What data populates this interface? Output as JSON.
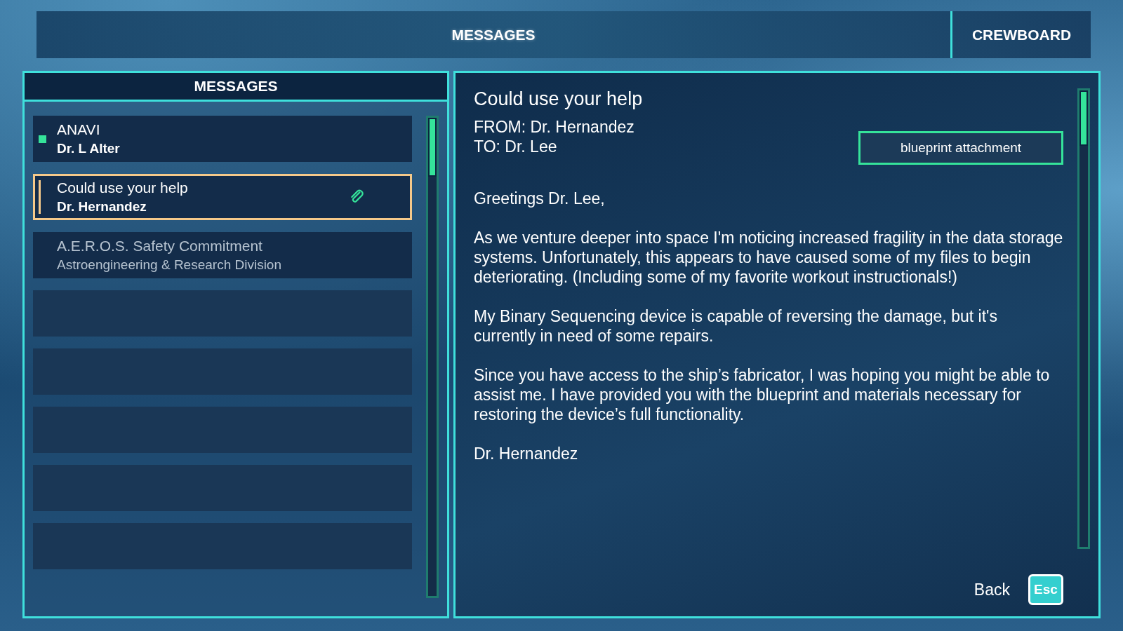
{
  "top_tabs": [
    {
      "label": "MESSAGES",
      "selected": true
    },
    {
      "label": "CREWBOARD",
      "selected": false
    }
  ],
  "message_list": {
    "title": "MESSAGES",
    "items": [
      {
        "subject": "ANAVI",
        "sender": "Dr. L Alter",
        "unread": true,
        "selected": false,
        "dimmed": false,
        "attachment": false
      },
      {
        "subject": "Could use your help",
        "sender": "Dr. Hernandez",
        "unread": false,
        "selected": true,
        "dimmed": false,
        "attachment": true
      },
      {
        "subject": "A.E.R.O.S. Safety Commitment",
        "sender": "Astroengineering & Research Division",
        "unread": false,
        "selected": false,
        "dimmed": true,
        "attachment": false
      }
    ]
  },
  "message": {
    "subject": "Could use your help",
    "from": "FROM: Dr. Hernandez",
    "to": "TO: Dr. Lee",
    "attachment_button": "blueprint attachment",
    "body": [
      "Greetings Dr. Lee,",
      "As we venture deeper into space I'm noticing increased fragility in the data storage systems. Unfortunately, this appears to have caused some of my files to begin deteriorating. (Including some of my favorite workout instructionals!)",
      "My Binary Sequencing device is capable of reversing the damage, but it's currently in need of some repairs.",
      "Since you have access to the ship’s fabricator, I was hoping you might be able to assist me. I have provided you with the blueprint and materials necessary for restoring the device’s full functionality.",
      "Dr. Hernandez"
    ]
  },
  "back": {
    "label": "Back",
    "key": "Esc"
  }
}
